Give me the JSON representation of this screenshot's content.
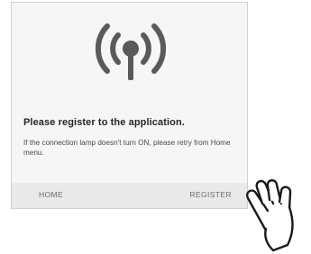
{
  "dialog": {
    "icon": "wireless-signal-icon",
    "title": "Please register to the application.",
    "message": "If the connection lamp doesn't turn ON, please retry from Home menu."
  },
  "footer": {
    "home_label": "HOME",
    "register_label": "REGISTER"
  },
  "pointer": {
    "icon": "pointing-hand-icon"
  },
  "colors": {
    "dialog_bg": "#f6f6f6",
    "footer_bg": "#e9e9e9",
    "icon_gray": "#5a5a5a"
  }
}
